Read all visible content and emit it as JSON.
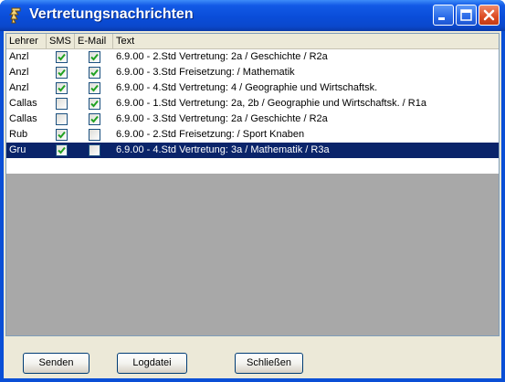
{
  "window": {
    "title": "Vertretungsnachrichten"
  },
  "columns": [
    "Lehrer",
    "SMS",
    "E-Mail",
    "Text"
  ],
  "rows": [
    {
      "lehrer": "Anzl",
      "sms": true,
      "email": true,
      "text": "6.9.00 - 2.Std  Vertretung: 2a / Geschichte / R2a",
      "selected": false
    },
    {
      "lehrer": "Anzl",
      "sms": true,
      "email": true,
      "text": "6.9.00 - 3.Std  Freisetzung:  / Mathematik",
      "selected": false
    },
    {
      "lehrer": "Anzl",
      "sms": true,
      "email": true,
      "text": "6.9.00 - 4.Std  Vertretung: 4 / Geographie und Wirtschaftsk.",
      "selected": false
    },
    {
      "lehrer": "Callas",
      "sms": false,
      "email": true,
      "text": "6.9.00 - 1.Std  Vertretung: 2a, 2b / Geographie und Wirtschaftsk. / R1a",
      "selected": false
    },
    {
      "lehrer": "Callas",
      "sms": false,
      "email": true,
      "text": "6.9.00 - 3.Std  Vertretung: 2a / Geschichte / R2a",
      "selected": false
    },
    {
      "lehrer": "Rub",
      "sms": true,
      "email": false,
      "text": "6.9.00 - 2.Std  Freisetzung:  / Sport Knaben",
      "selected": false
    },
    {
      "lehrer": "Gru",
      "sms": true,
      "email": false,
      "text": "6.9.00 - 4.Std  Vertretung: 3a / Mathematik / R3a",
      "selected": true
    }
  ],
  "buttons": {
    "send": "Senden",
    "log": "Logdatei",
    "close": "Schließen"
  },
  "icons": {
    "app": "app-icon",
    "minimize": "minimize-icon",
    "maximize": "maximize-icon",
    "close": "close-icon",
    "check": "checkmark-icon"
  },
  "colors": {
    "titlebar": "#0a4dd9",
    "selection": "#0a246a",
    "checkmark": "#21a121",
    "close_button": "#dc4b22",
    "face": "#ece9d8"
  }
}
